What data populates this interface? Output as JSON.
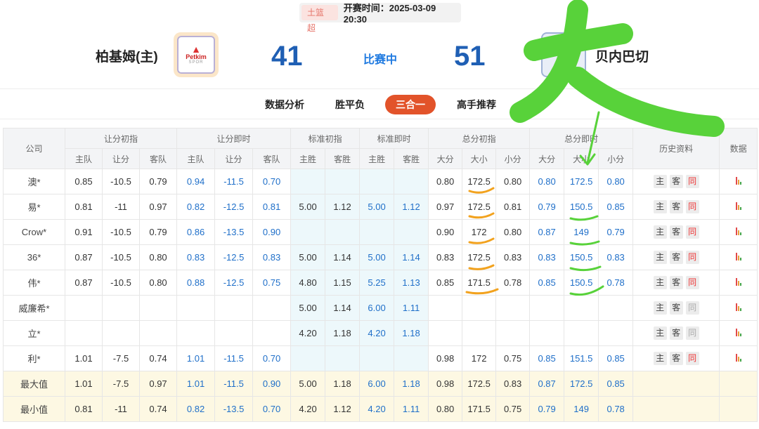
{
  "header": {
    "league": "土篮超",
    "kickoff": "开赛时间：2025-03-09 20:30",
    "home": {
      "name": "柏基姆(主)",
      "score": "41",
      "logo_brand": "Petkim",
      "logo_sub": "SPOR"
    },
    "status": "比赛中",
    "away": {
      "name": "贝内巴切",
      "score": "51"
    }
  },
  "tabs": [
    "数据分析",
    "胜平负",
    "三合一",
    "高手推荐"
  ],
  "active_tab": "三合一",
  "table": {
    "col_company": "公司",
    "groups": [
      "让分初指",
      "让分即时",
      "标准初指",
      "标准即时",
      "总分初指",
      "总分即时",
      "历史资料",
      "数据"
    ],
    "sub": {
      "handicap": [
        "主队",
        "让分",
        "客队"
      ],
      "std": [
        "主胜",
        "客胜"
      ],
      "total": [
        "大分",
        "大小",
        "小分"
      ]
    },
    "history_buttons": [
      "主",
      "客",
      "同"
    ],
    "rows": [
      {
        "company": "澳*",
        "h_init": [
          "0.85",
          "-10.5",
          "0.79"
        ],
        "h_now": [
          "0.94",
          "-11.5",
          "0.70"
        ],
        "s_init": [
          "",
          ""
        ],
        "s_now": [
          "",
          ""
        ],
        "t_init": [
          "0.80",
          "172.5",
          "0.80"
        ],
        "t_now": [
          "0.80",
          "172.5",
          "0.80"
        ],
        "same_active": true
      },
      {
        "company": "易*",
        "h_init": [
          "0.81",
          "-11",
          "0.97"
        ],
        "h_now": [
          "0.82",
          "-12.5",
          "0.81"
        ],
        "s_init": [
          "5.00",
          "1.12"
        ],
        "s_now": [
          "5.00",
          "1.12"
        ],
        "t_init": [
          "0.97",
          "172.5",
          "0.81"
        ],
        "t_now": [
          "0.79",
          "150.5",
          "0.85"
        ],
        "same_active": true
      },
      {
        "company": "Crow*",
        "h_init": [
          "0.91",
          "-10.5",
          "0.79"
        ],
        "h_now": [
          "0.86",
          "-13.5",
          "0.90"
        ],
        "s_init": [
          "",
          ""
        ],
        "s_now": [
          "",
          ""
        ],
        "t_init": [
          "0.90",
          "172",
          "0.80"
        ],
        "t_now": [
          "0.87",
          "149",
          "0.79"
        ],
        "same_active": true
      },
      {
        "company": "36*",
        "h_init": [
          "0.87",
          "-10.5",
          "0.80"
        ],
        "h_now": [
          "0.83",
          "-12.5",
          "0.83"
        ],
        "s_init": [
          "5.00",
          "1.14"
        ],
        "s_now": [
          "5.00",
          "1.14"
        ],
        "t_init": [
          "0.83",
          "172.5",
          "0.83"
        ],
        "t_now": [
          "0.83",
          "150.5",
          "0.83"
        ],
        "same_active": true
      },
      {
        "company": "伟*",
        "h_init": [
          "0.87",
          "-10.5",
          "0.80"
        ],
        "h_now": [
          "0.88",
          "-12.5",
          "0.75"
        ],
        "s_init": [
          "4.80",
          "1.15"
        ],
        "s_now": [
          "5.25",
          "1.13"
        ],
        "t_init": [
          "0.85",
          "171.5",
          "0.78"
        ],
        "t_now": [
          "0.85",
          "150.5",
          "0.78"
        ],
        "same_active": true
      },
      {
        "company": "威廉希*",
        "h_init": [
          "",
          "",
          ""
        ],
        "h_now": [
          "",
          "",
          ""
        ],
        "s_init": [
          "5.00",
          "1.14"
        ],
        "s_now": [
          "6.00",
          "1.11"
        ],
        "t_init": [
          "",
          "",
          ""
        ],
        "t_now": [
          "",
          "",
          ""
        ],
        "same_active": false
      },
      {
        "company": "立*",
        "h_init": [
          "",
          "",
          ""
        ],
        "h_now": [
          "",
          "",
          ""
        ],
        "s_init": [
          "4.20",
          "1.18"
        ],
        "s_now": [
          "4.20",
          "1.18"
        ],
        "t_init": [
          "",
          "",
          ""
        ],
        "t_now": [
          "",
          "",
          ""
        ],
        "same_active": false
      },
      {
        "company": "利*",
        "h_init": [
          "1.01",
          "-7.5",
          "0.74"
        ],
        "h_now": [
          "1.01",
          "-11.5",
          "0.70"
        ],
        "s_init": [
          "",
          ""
        ],
        "s_now": [
          "",
          ""
        ],
        "t_init": [
          "0.98",
          "172",
          "0.75"
        ],
        "t_now": [
          "0.85",
          "151.5",
          "0.85"
        ],
        "same_active": true
      }
    ],
    "summary": [
      {
        "label": "最大值",
        "h_init": [
          "1.01",
          "-7.5",
          "0.97"
        ],
        "h_now": [
          "1.01",
          "-11.5",
          "0.90"
        ],
        "s_init": [
          "5.00",
          "1.18"
        ],
        "s_now": [
          "6.00",
          "1.18"
        ],
        "t_init": [
          "0.98",
          "172.5",
          "0.83"
        ],
        "t_now": [
          "0.87",
          "172.5",
          "0.85"
        ]
      },
      {
        "label": "最小值",
        "h_init": [
          "0.81",
          "-11",
          "0.74"
        ],
        "h_now": [
          "0.82",
          "-13.5",
          "0.70"
        ],
        "s_init": [
          "4.20",
          "1.12"
        ],
        "s_now": [
          "4.20",
          "1.11"
        ],
        "t_init": [
          "0.80",
          "171.5",
          "0.75"
        ],
        "t_now": [
          "0.79",
          "149",
          "0.78"
        ]
      }
    ]
  },
  "annotation": {
    "big_char": "大",
    "colors": {
      "green": "#58d23a",
      "orange": "#f2a21e"
    }
  },
  "colors": {
    "accent_blue": "#1f6fc9",
    "tab_active": "#e2532a",
    "std_bg": "#edf8fb",
    "summary_bg": "#fdf8e3"
  }
}
